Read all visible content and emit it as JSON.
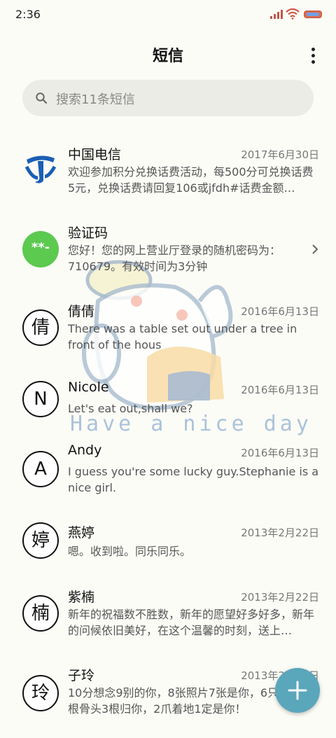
{
  "status": {
    "time": "2:36"
  },
  "header": {
    "title": "短信"
  },
  "search": {
    "placeholder": "搜索11条短信"
  },
  "decoration": {
    "text": "Have a nice day"
  },
  "messages": [
    {
      "name": "中国电信",
      "date": "2017年6月30日",
      "preview": "欢迎参加积分兑换话费活动，每500分可兑换话费5元，兑换话费请回复106或jfdh#话费金额…",
      "avatar": "telecom-logo"
    },
    {
      "name": "验证码",
      "date": "",
      "preview": "您好！您的网上营业厅登录的随机密码为：710679。有效时间为3分钟",
      "avatar": "**-"
    },
    {
      "name": "倩倩",
      "date": "2016年6月13日",
      "preview": "There was a table set out under a tree in front of the hous",
      "avatar": "倩"
    },
    {
      "name": "Nicole",
      "date": "2016年6月13日",
      "preview": "Let's eat out,shall we?",
      "avatar": "N"
    },
    {
      "name": "Andy",
      "date": "2016年6月13日",
      "preview": "I guess you're some lucky guy.Stephanie is a nice girl.",
      "avatar": "A"
    },
    {
      "name": "燕婷",
      "date": "2013年2月22日",
      "preview": "嗯。收到啦。同乐同乐。",
      "avatar": "婷"
    },
    {
      "name": "紫楠",
      "date": "2013年2月22日",
      "preview": "新年的祝福数不胜数，新年的愿望好多好多，新年的问候依旧美好，在这个温馨的时刻，送上…",
      "avatar": "楠"
    },
    {
      "name": "子玲",
      "date": "2013年2月22日",
      "preview": "10分想念9别的你，8张照片7张是你，6只像你，4根骨头3根归你，2爪着地1定是你！",
      "avatar": "玲"
    }
  ],
  "colors": {
    "fab": "#5aa6bb",
    "verify_avatar": "#5cc94f",
    "telecom_logo": "#1a5fb4"
  }
}
